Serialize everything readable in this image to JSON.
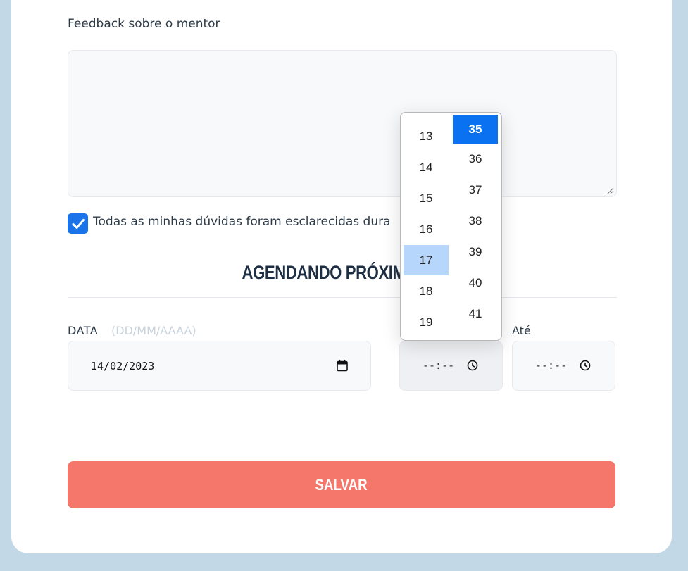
{
  "form": {
    "feedback_label": "Feedback sobre o mentor",
    "feedback_value": "",
    "doubts_checkbox": {
      "checked": true,
      "label": "Todas as minhas dúvidas foram esclarecidas dura"
    }
  },
  "schedule": {
    "title": "AGENDANDO PRÓXIMA ME",
    "date_label": "DATA",
    "date_hint": "(DD/MM/AAAA)",
    "date_value": "14/02/2023",
    "time_start_value": "--:--",
    "time_end_label": "Até",
    "time_end_value": "--:--"
  },
  "time_picker": {
    "hours": [
      "13",
      "14",
      "15",
      "16",
      "17",
      "18",
      "19"
    ],
    "minutes": [
      "35",
      "36",
      "37",
      "38",
      "39",
      "40",
      "41"
    ],
    "selected_hour": "17",
    "selected_minute": "35"
  },
  "actions": {
    "save_label": "SALVAR"
  },
  "colors": {
    "background": "#c2d8e6",
    "accent": "#f5776b",
    "checkbox": "#1a73e8",
    "picker_selected": "#0a72f0",
    "picker_hover": "#b7d6fb"
  }
}
